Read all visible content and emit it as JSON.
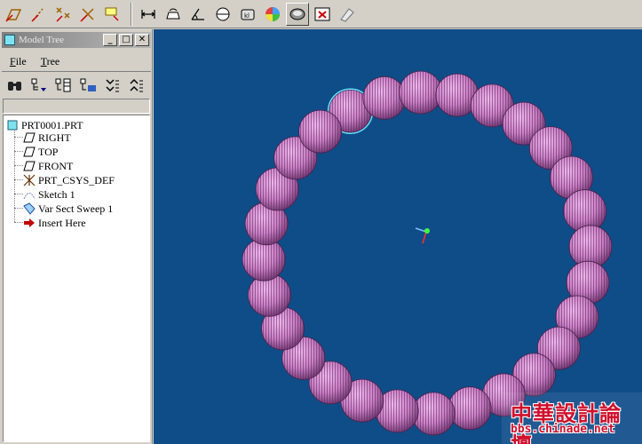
{
  "toolbar": {
    "buttons": [
      {
        "name": "datum-plane-display-icon"
      },
      {
        "name": "datum-axis-display-icon"
      },
      {
        "name": "datum-point-display-icon"
      },
      {
        "name": "coordinate-system-display-icon"
      },
      {
        "name": "annotation-display-icon"
      },
      {
        "name": "measure-distance-icon"
      },
      {
        "name": "measure-area-icon"
      },
      {
        "name": "measure-angle-icon"
      },
      {
        "name": "measure-diameter-icon"
      },
      {
        "name": "model-analysis-icon"
      },
      {
        "name": "color-appearance-icon"
      },
      {
        "name": "shading-icon",
        "pressed": true
      },
      {
        "name": "close-window-icon"
      },
      {
        "name": "regenerate-icon"
      }
    ]
  },
  "model_tree": {
    "title": "Model Tree",
    "menu": [
      {
        "label": "File",
        "underline": "F",
        "rest": "ile"
      },
      {
        "label": "Tree",
        "underline": "T",
        "rest": "ree"
      }
    ],
    "tools": [
      "find-icon",
      "settings-icon",
      "columns-icon",
      "show-icon",
      "expand-icon",
      "collapse-icon"
    ],
    "root": "PRT0001.PRT",
    "items": [
      {
        "label": "RIGHT",
        "icon": "datum-plane-icon"
      },
      {
        "label": "TOP",
        "icon": "datum-plane-icon"
      },
      {
        "label": "FRONT",
        "icon": "datum-plane-icon"
      },
      {
        "label": "PRT_CSYS_DEF",
        "icon": "csys-icon"
      },
      {
        "label": "Sketch 1",
        "icon": "sketch-icon"
      },
      {
        "label": "Var Sect Sweep 1",
        "icon": "sweep-icon"
      },
      {
        "label": "Insert Here",
        "icon": "insert-arrow-icon"
      }
    ]
  },
  "colors": {
    "viewport_bg": "#0f4d89",
    "bead": "#c97fc4",
    "bead_stripe": "#5b2a5f",
    "selection": "#5fe6ff"
  },
  "watermark": {
    "title": "中華設計論壇",
    "url": "bbs.chinade.net"
  }
}
